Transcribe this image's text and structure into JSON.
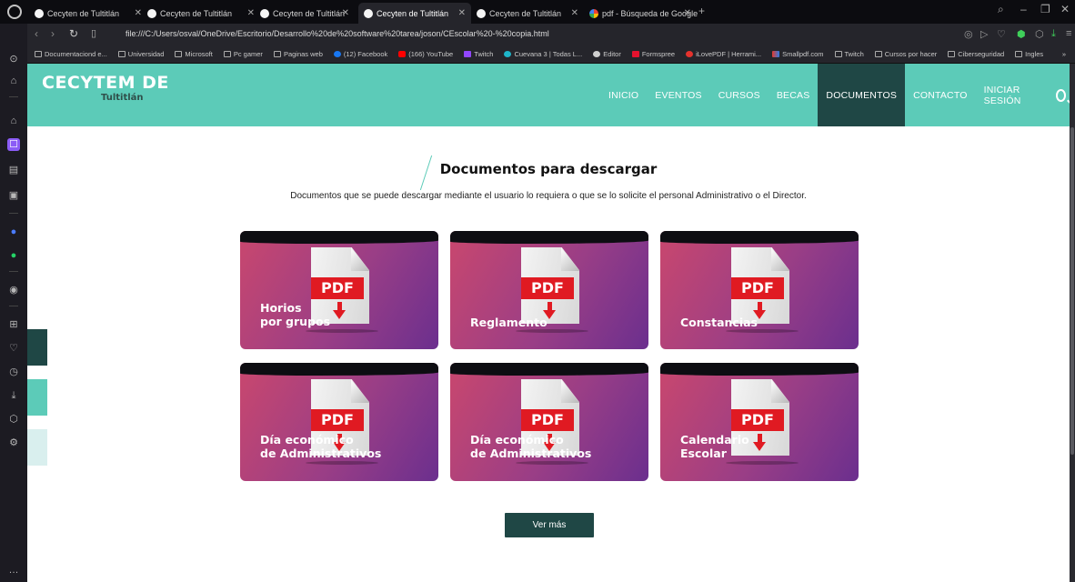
{
  "browser": {
    "tabs": [
      {
        "title": "Cecyten de Tultitlán"
      },
      {
        "title": "Cecyten de Tultitlán"
      },
      {
        "title": "Cecyten de Tultitlán"
      },
      {
        "title": "Cecyten de Tultitlán"
      },
      {
        "title": "Cecyten de Tultitlán"
      },
      {
        "title": "pdf - Búsqueda de Google"
      }
    ],
    "url": "file:///C:/Users/osval/OneDrive/Escritorio/Desarrollo%20de%20software%20tarea/joson/CEscolar%20-%20copia.html",
    "bookmarks": [
      {
        "label": "Documentaciond e...",
        "icon": "folder-icon"
      },
      {
        "label": "Universidad",
        "icon": "folder-icon"
      },
      {
        "label": "Microsoft",
        "icon": "folder-icon"
      },
      {
        "label": "Pc gamer",
        "icon": "folder-icon"
      },
      {
        "label": "Paginas web",
        "icon": "folder-icon"
      },
      {
        "label": "(12) Facebook",
        "icon": "facebook-icon"
      },
      {
        "label": "(166) YouTube",
        "icon": "youtube-icon"
      },
      {
        "label": "Twitch",
        "icon": "twitch-icon"
      },
      {
        "label": "Cuevana 3 | Todas L...",
        "icon": "cuevana-icon"
      },
      {
        "label": "Editor",
        "icon": "editor-icon"
      },
      {
        "label": "Formspree",
        "icon": "formspree-icon"
      },
      {
        "label": "iLovePDF | Herrami...",
        "icon": "ilovepdf-icon"
      },
      {
        "label": "Smallpdf.com",
        "icon": "smallpdf-icon"
      },
      {
        "label": "Twitch",
        "icon": "folder-icon"
      },
      {
        "label": "Cursos por hacer",
        "icon": "folder-icon"
      },
      {
        "label": "Ciberseguridad",
        "icon": "folder-icon"
      },
      {
        "label": "Ingles",
        "icon": "folder-icon"
      }
    ],
    "more_bookmarks": "»"
  },
  "site": {
    "logo_main": "CECYTEM DE",
    "logo_sub": "Tultitlán",
    "menu": [
      {
        "label": "INICIO"
      },
      {
        "label": "EVENTOS"
      },
      {
        "label": "CURSOS"
      },
      {
        "label": "BECAS"
      },
      {
        "label": "DOCUMENTOS"
      },
      {
        "label": "CONTACTO"
      },
      {
        "label": "INICIAR SESIÓN"
      }
    ],
    "active_menu": "DOCUMENTOS",
    "section": {
      "title": "Documentos para descargar",
      "description": "Documentos que se puede descargar mediante el usuario lo requiera o que se lo solicite el personal Administrativo o el Director."
    },
    "cards": [
      {
        "line1": "Horios",
        "line2": "por grupos",
        "pdf": "PDF"
      },
      {
        "line1": "Reglamento",
        "line2": "",
        "pdf": "PDF"
      },
      {
        "line1": "Constancias",
        "line2": "",
        "pdf": "PDF"
      },
      {
        "line1": "Día económico",
        "line2": "de Administrativos",
        "pdf": "PDF"
      },
      {
        "line1": "Día económico",
        "line2": "de Administrativos",
        "pdf": "PDF"
      },
      {
        "line1": "Calendario",
        "line2": "Escolar",
        "pdf": "PDF"
      }
    ],
    "more_button": "Ver más",
    "colors": {
      "header": "#5ccbb8",
      "dark_teal": "#1f4745",
      "pdf_red": "#e01a22"
    }
  }
}
